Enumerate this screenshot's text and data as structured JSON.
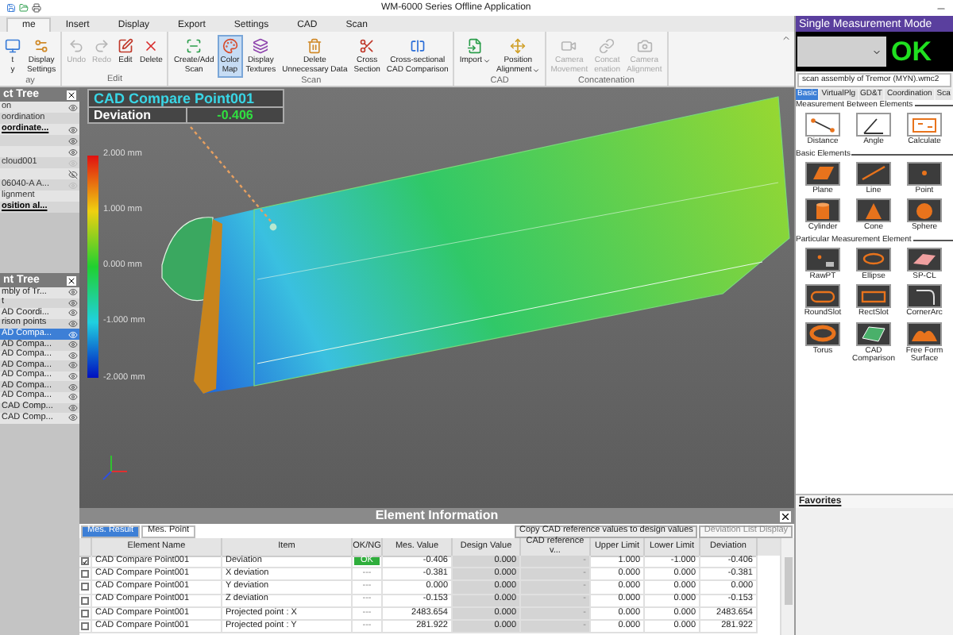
{
  "window": {
    "title": "WM-6000 Series Offline Application"
  },
  "ribbon_tabs": [
    {
      "label": "me",
      "selected": true
    },
    {
      "label": "Insert",
      "selected": false
    },
    {
      "label": "Display",
      "selected": false
    },
    {
      "label": "Export",
      "selected": false
    },
    {
      "label": "Settings",
      "selected": false
    },
    {
      "label": "CAD",
      "selected": false
    },
    {
      "label": "Scan",
      "selected": false
    }
  ],
  "ribbon_groups": [
    {
      "label": "ay",
      "buttons": [
        {
          "lines": [
            "t",
            "y"
          ],
          "selected": false,
          "disabled": false
        },
        {
          "lines": [
            "Display",
            "Settings"
          ],
          "selected": false,
          "disabled": false
        }
      ]
    },
    {
      "label": "Edit",
      "buttons": [
        {
          "lines": [
            "Undo"
          ],
          "selected": false,
          "disabled": true
        },
        {
          "lines": [
            "Redo"
          ],
          "selected": false,
          "disabled": true
        },
        {
          "lines": [
            "Edit"
          ],
          "selected": false,
          "disabled": false
        },
        {
          "lines": [
            "Delete"
          ],
          "selected": false,
          "disabled": false
        }
      ]
    },
    {
      "label": "Scan",
      "buttons": [
        {
          "lines": [
            "Create/Add",
            "Scan"
          ],
          "selected": false,
          "disabled": false
        },
        {
          "lines": [
            "Color",
            "Map"
          ],
          "selected": true,
          "disabled": false
        },
        {
          "lines": [
            "Display",
            "Textures"
          ],
          "selected": false,
          "disabled": false
        },
        {
          "lines": [
            "Delete",
            "Unnecessary Data"
          ],
          "selected": false,
          "disabled": false
        },
        {
          "lines": [
            "Cross",
            "Section"
          ],
          "selected": false,
          "disabled": false
        },
        {
          "lines": [
            "Cross-sectional",
            "CAD Comparison"
          ],
          "selected": false,
          "disabled": false
        }
      ]
    },
    {
      "label": "CAD",
      "buttons": [
        {
          "lines": [
            "Import"
          ],
          "selected": false,
          "disabled": false,
          "dropdown": true
        },
        {
          "lines": [
            "Position",
            "Alignment"
          ],
          "selected": false,
          "disabled": false,
          "dropdown": true
        }
      ]
    },
    {
      "label": "Concatenation",
      "buttons": [
        {
          "lines": [
            "Camera",
            "Movement"
          ],
          "selected": false,
          "disabled": true
        },
        {
          "lines": [
            "Concat",
            "enation"
          ],
          "selected": false,
          "disabled": true
        },
        {
          "lines": [
            "Camera",
            "Alignment"
          ],
          "selected": false,
          "disabled": true
        }
      ]
    }
  ],
  "object_tree": {
    "title": "ct Tree",
    "items": [
      {
        "label": "on",
        "emphasis": false,
        "eye": true,
        "visible": true,
        "dim": false
      },
      {
        "label": "oordination",
        "emphasis": false,
        "eye": false
      },
      {
        "label": "oordinate...",
        "emphasis": true,
        "eye": true,
        "visible": true,
        "dim": false
      },
      {
        "eye": true,
        "visible": true,
        "dim": false
      },
      {
        "eye": true,
        "visible": true,
        "dim": false
      },
      {
        "label": "cloud001",
        "emphasis": false,
        "eye": true,
        "visible": true,
        "dim": true
      },
      {
        "eye": true,
        "visible": false,
        "dim": false
      },
      {
        "label": "06040-A A...",
        "emphasis": false,
        "eye": true,
        "visible": true,
        "dim": true
      },
      {
        "label": "lignment",
        "emphasis": false,
        "eye": false
      },
      {
        "label": "osition al...",
        "emphasis": true,
        "eye": false
      }
    ]
  },
  "element_tree": {
    "title": "nt Tree",
    "items": [
      {
        "label": "mbly of Tr...",
        "selected": false
      },
      {
        "label": "t",
        "selected": false
      },
      {
        "label": "AD Coordi...",
        "selected": false
      },
      {
        "label": "rison points",
        "selected": false
      },
      {
        "label": "AD Compa...",
        "selected": true
      },
      {
        "label": "AD Compa...",
        "selected": false
      },
      {
        "label": "AD Compa...",
        "selected": false
      },
      {
        "label": "AD Compa...",
        "selected": false
      },
      {
        "label": "AD Compa...",
        "selected": false
      },
      {
        "label": "AD Compa...",
        "selected": false
      },
      {
        "label": "AD Compa...",
        "selected": false
      },
      {
        "label": "CAD Comp...",
        "selected": false
      },
      {
        "label": "CAD Comp...",
        "selected": false
      }
    ]
  },
  "viewport": {
    "callout": {
      "title": "CAD Compare Point001",
      "item": "Deviation",
      "value": "-0.406"
    },
    "scale_labels": [
      "2.000 mm",
      "1.000 mm",
      "0.000 mm",
      "-1.000 mm",
      "-2.000 mm"
    ]
  },
  "element_info": {
    "title": "Element Information",
    "tabs": [
      {
        "label": "Mes. Result",
        "selected": true
      },
      {
        "label": "Mes. Point",
        "selected": false
      }
    ],
    "buttons": [
      {
        "label": "Copy CAD reference values to design values",
        "disabled": false
      },
      {
        "label": "Deviation List Display",
        "disabled": true
      }
    ],
    "columns": [
      "Element Name",
      "Item",
      "OK/NG",
      "Mes. Value",
      "Design Value",
      "CAD reference v...",
      "Upper Limit",
      "Lower Limit",
      "Deviation"
    ],
    "rows": [
      {
        "checked": true,
        "passed": true,
        "cells": [
          "CAD Compare Point001",
          "Deviation",
          "OK",
          "-0.406",
          "0.000",
          "-",
          "1.000",
          "-1.000",
          "-0.406"
        ]
      },
      {
        "checked": false,
        "passed": false,
        "cells": [
          "CAD Compare Point001",
          "X deviation",
          "---",
          "-0.381",
          "0.000",
          "-",
          "0.000",
          "0.000",
          "-0.381"
        ]
      },
      {
        "checked": false,
        "passed": false,
        "cells": [
          "CAD Compare Point001",
          "Y deviation",
          "---",
          "0.000",
          "0.000",
          "-",
          "0.000",
          "0.000",
          "0.000"
        ]
      },
      {
        "checked": false,
        "passed": false,
        "cells": [
          "CAD Compare Point001",
          "Z deviation",
          "---",
          "-0.153",
          "0.000",
          "-",
          "0.000",
          "0.000",
          "-0.153"
        ]
      },
      {
        "checked": false,
        "passed": false,
        "cells": [
          "CAD Compare Point001",
          "Projected point : X",
          "---",
          "2483.654",
          "0.000",
          "-",
          "0.000",
          "0.000",
          "2483.654"
        ]
      },
      {
        "checked": false,
        "passed": false,
        "cells": [
          "CAD Compare Point001",
          "Projected point : Y",
          "---",
          "281.922",
          "0.000",
          "-",
          "0.000",
          "0.000",
          "281.922"
        ]
      }
    ]
  },
  "mode_panel": {
    "title": "Single Measurement Mode",
    "status": "OK",
    "file": "scan assembly of Tremor (MYN).wmc2",
    "tabs": [
      {
        "label": "Basic",
        "selected": true
      },
      {
        "label": "VirtualPlg",
        "selected": false
      },
      {
        "label": "GD&T",
        "selected": false
      },
      {
        "label": "Coordination",
        "selected": false
      },
      {
        "label": "Sca",
        "selected": false
      }
    ],
    "sections": [
      {
        "title": "Measurement Between Elements",
        "tools": [
          [
            "Distance"
          ],
          [
            "Angle"
          ],
          [
            "Calculate"
          ]
        ]
      },
      {
        "title": "Basic Elements",
        "tools": [
          [
            "Plane"
          ],
          [
            "Line"
          ],
          [
            "Point"
          ],
          [
            "Cylinder"
          ],
          [
            "Cone"
          ],
          [
            "Sphere"
          ]
        ]
      },
      {
        "title": "Particular Measurement Element",
        "tools": [
          [
            "RawPT"
          ],
          [
            "Ellipse"
          ],
          [
            "SP-CL"
          ],
          [
            "RoundSlot"
          ],
          [
            "RectSlot"
          ],
          [
            "CornerArc"
          ],
          [
            "Torus"
          ],
          [
            "CAD",
            "Comparison"
          ],
          [
            "Free Form",
            "Surface"
          ]
        ]
      }
    ],
    "favorites": "Favorites"
  }
}
